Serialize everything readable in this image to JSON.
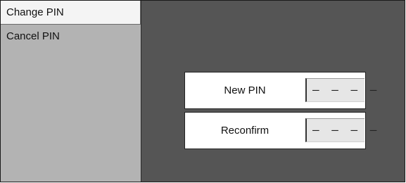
{
  "menu": {
    "items": [
      {
        "label": "Change PIN",
        "selected": true
      },
      {
        "label": "Cancel PIN",
        "selected": false
      }
    ]
  },
  "form": {
    "new_pin": {
      "label": "New PIN",
      "value": "– – – –"
    },
    "reconfirm": {
      "label": "Reconfirm",
      "value": "– – – –"
    }
  },
  "colors": {
    "background": "#555555",
    "sidebar": "#b3b3b3",
    "selected_item": "#f4f4f4",
    "field": "#e6e6e6"
  }
}
